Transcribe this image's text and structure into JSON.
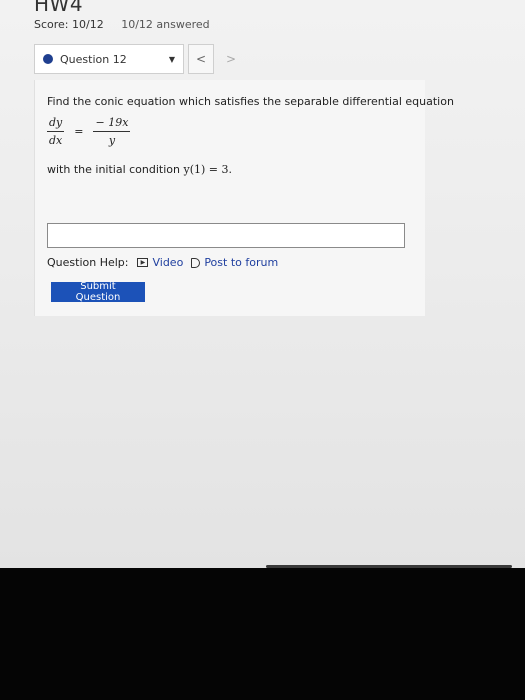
{
  "assignment": {
    "title": "HW4",
    "score": "Score: 10/12",
    "answered": "10/12 answered"
  },
  "question_nav": {
    "selected": "Question 12",
    "prev_label": "<",
    "next_label": ">",
    "status_dot_color": "#1f3f8f"
  },
  "question": {
    "prompt": "Find the conic equation which satisfies the separable differential equation",
    "lhs_numerator": "dy",
    "lhs_denominator": "dx",
    "equals": "=",
    "rhs_numerator": "− 19x",
    "rhs_denominator": "y",
    "condition_prefix": "with the initial condition ",
    "condition_math": "y(1) = 3."
  },
  "answer": {
    "value": ""
  },
  "help": {
    "label": "Question Help:",
    "video_icon": "video-icon",
    "video_label": "Video",
    "forum_icon": "forum-icon",
    "forum_label": "Post to forum"
  },
  "submit": {
    "label": "Submit Question",
    "color": "#1c52b8"
  }
}
